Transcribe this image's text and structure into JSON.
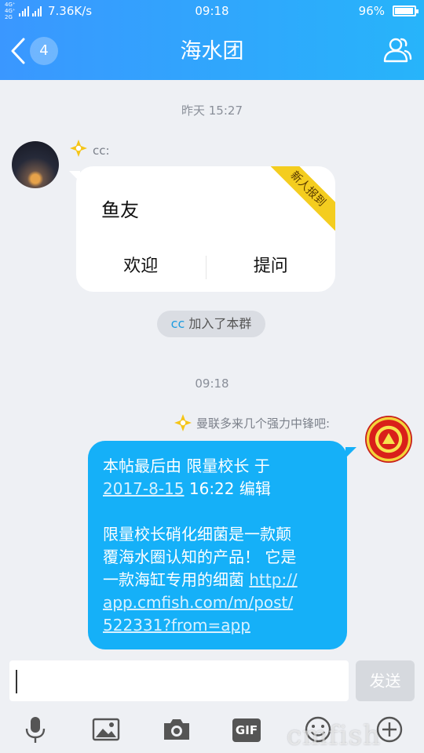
{
  "status_bar": {
    "network_label": "4G⁺ 4G⁺ 2G",
    "speed": "7.36K/s",
    "time": "09:18",
    "battery": "96%",
    "battery_level": 0.96
  },
  "header": {
    "unread_count": "4",
    "title": "海水团"
  },
  "chat": {
    "time_1": "昨天 15:27",
    "msg1": {
      "sender": "cc:",
      "card_title": "鱼友",
      "ribbon": "新人报到",
      "action_welcome": "欢迎",
      "action_ask": "提问"
    },
    "system": {
      "name": "cc",
      "text": "加入了本群"
    },
    "time_2": "09:18",
    "msg2": {
      "sender": "曼联多来几个强力中锋吧:",
      "line1": " 本帖最后由 限量校长 于",
      "date_link": "2017-8-15",
      "line2_rest": " 16:22 编辑",
      "line3": "限量校长硝化细菌是一款颠",
      "line4": "覆海水圈认知的产品！ 它是",
      "line5_text": "一款海缸专用的细菌 ",
      "link_part1": "http://",
      "link_part2": "app.cmfish.com/m/post/",
      "link_part3": "522331?from=app"
    }
  },
  "input": {
    "send_label": "发送"
  },
  "toolbar": {
    "gif_label": "GIF",
    "watermark": "cmfish"
  },
  "colors": {
    "header_gradient": [
      "#3a97ff",
      "#27b4fa"
    ],
    "bubble_blue": "#15b0f8",
    "ribbon_yellow": "#f4cd1f",
    "background": "#eef0f4"
  }
}
